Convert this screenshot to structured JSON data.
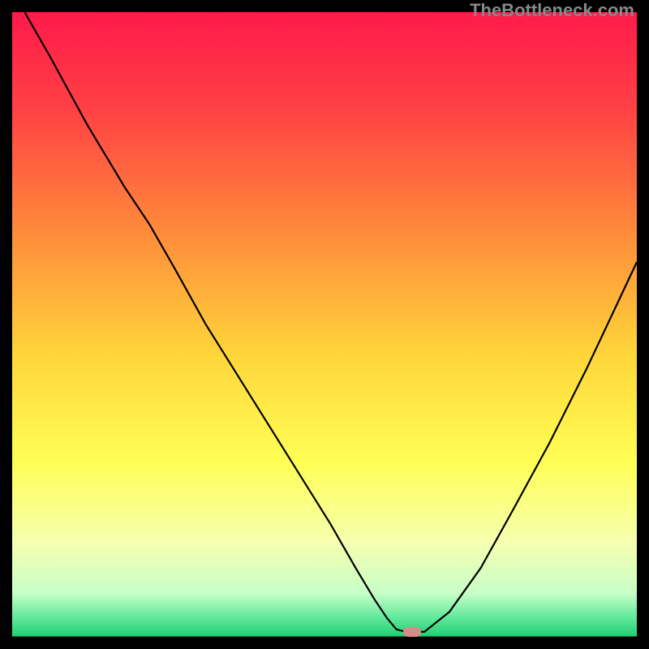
{
  "watermark": "TheBottleneck.com",
  "chart_data": {
    "type": "line",
    "title": "",
    "xlabel": "",
    "ylabel": "",
    "xlim": [
      0,
      100
    ],
    "ylim": [
      0,
      100
    ],
    "grid": false,
    "legend": false,
    "background_gradient": {
      "stops": [
        {
          "pos": 0.0,
          "color": "#ff1a4a"
        },
        {
          "pos": 0.15,
          "color": "#ff3f45"
        },
        {
          "pos": 0.35,
          "color": "#ff8a3a"
        },
        {
          "pos": 0.55,
          "color": "#ffd63a"
        },
        {
          "pos": 0.72,
          "color": "#ffff55"
        },
        {
          "pos": 0.85,
          "color": "#f5ffb0"
        },
        {
          "pos": 0.93,
          "color": "#c8ffc8"
        },
        {
          "pos": 0.97,
          "color": "#5fe89a"
        },
        {
          "pos": 1.0,
          "color": "#1ecf72"
        }
      ]
    },
    "series": [
      {
        "name": "bottleneck-curve",
        "color": "#000000",
        "x": [
          2,
          6,
          12,
          18,
          22,
          26,
          31,
          36,
          41,
          46,
          51,
          55,
          58,
          60,
          61.5,
          63,
          64,
          66,
          70,
          75,
          80,
          86,
          92,
          100
        ],
        "y": [
          100,
          93,
          82,
          72,
          66,
          59,
          50,
          42,
          34,
          26,
          18,
          11,
          6,
          3,
          1.2,
          0.8,
          0.8,
          0.8,
          4,
          11,
          20,
          31,
          43,
          60
        ]
      }
    ],
    "marker": {
      "x": 64,
      "y": 0.8,
      "color": "#d98a8a"
    }
  }
}
